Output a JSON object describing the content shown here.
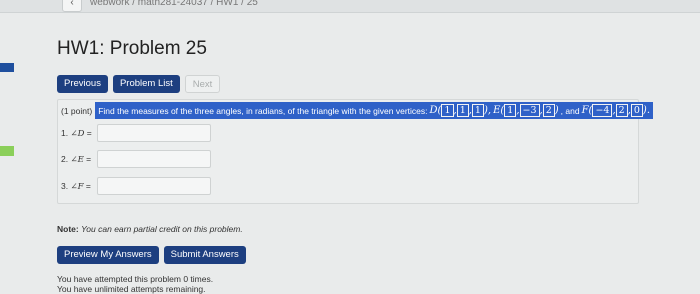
{
  "browser": {
    "back_glyph": "‹",
    "breadcrumb": "webwork / math281-24037 / HW1 / 25"
  },
  "page_title": "HW1: Problem 25",
  "nav": {
    "previous": "Previous",
    "problem_list": "Problem List",
    "next": "Next"
  },
  "problem": {
    "points": "(1 point)",
    "statement": "Find the measures of the three angles, in radians, of the triangle with the given vertices:",
    "vertices": [
      {
        "name": "D",
        "coords": [
          "1",
          "1",
          "1"
        ]
      },
      {
        "name": "E",
        "coords": [
          "1",
          "−3",
          "2"
        ]
      },
      {
        "name": "F",
        "coords": [
          "−4",
          "2",
          "0"
        ]
      }
    ],
    "and_word": ", and",
    "answers": [
      {
        "number": "1.",
        "angle": "∠D",
        "eq": "=",
        "value": ""
      },
      {
        "number": "2.",
        "angle": "∠E",
        "eq": "=",
        "value": ""
      },
      {
        "number": "3.",
        "angle": "∠F",
        "eq": "=",
        "value": ""
      }
    ]
  },
  "note": {
    "label": "Note:",
    "text": "You can earn partial credit on this problem."
  },
  "actions": {
    "preview": "Preview My Answers",
    "submit": "Submit Answers"
  },
  "attempts": {
    "line1": "You have attempted this problem 0 times.",
    "line2": "You have unlimited attempts remaining."
  },
  "colors": {
    "button_blue": "#1d3f80",
    "highlight_blue": "#2f61c8",
    "left_mark_blue": "#1f4f9e",
    "left_mark_green": "#8bcf5a"
  }
}
